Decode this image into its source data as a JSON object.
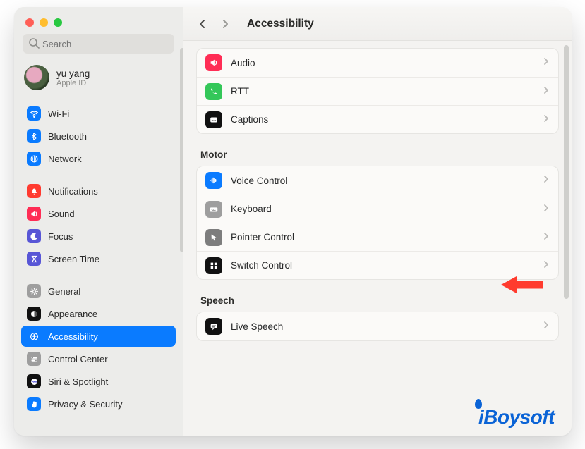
{
  "sidebar": {
    "search_placeholder": "Search",
    "account": {
      "name": "yu yang",
      "sub": "Apple ID"
    },
    "items": [
      {
        "id": "wifi",
        "label": "Wi-Fi",
        "icon": "wifi-icon",
        "color": "#0a7bff"
      },
      {
        "id": "bluetooth",
        "label": "Bluetooth",
        "icon": "bluetooth-icon",
        "color": "#0a7bff"
      },
      {
        "id": "network",
        "label": "Network",
        "icon": "globe-icon",
        "color": "#0a7bff"
      },
      {
        "id": "notifications",
        "label": "Notifications",
        "icon": "bell-icon",
        "color": "#ff3b30"
      },
      {
        "id": "sound",
        "label": "Sound",
        "icon": "speaker-icon",
        "color": "#ff2d55"
      },
      {
        "id": "focus",
        "label": "Focus",
        "icon": "moon-icon",
        "color": "#5856d6"
      },
      {
        "id": "screentime",
        "label": "Screen Time",
        "icon": "hourglass-icon",
        "color": "#5856d6"
      },
      {
        "id": "general",
        "label": "General",
        "icon": "gear-icon",
        "color": "#9e9e9e"
      },
      {
        "id": "appearance",
        "label": "Appearance",
        "icon": "appearance-icon",
        "color": "#111"
      },
      {
        "id": "accessibility",
        "label": "Accessibility",
        "icon": "accessibility-icon",
        "color": "#0a7bff",
        "selected": true
      },
      {
        "id": "controlcenter",
        "label": "Control Center",
        "icon": "switches-icon",
        "color": "#9e9e9e"
      },
      {
        "id": "siri",
        "label": "Siri & Spotlight",
        "icon": "siri-icon",
        "color": "#111"
      },
      {
        "id": "privacy",
        "label": "Privacy & Security",
        "icon": "hand-icon",
        "color": "#0a7bff"
      }
    ]
  },
  "header": {
    "title": "Accessibility",
    "back_enabled": true,
    "forward_enabled": false
  },
  "main": {
    "groups": [
      {
        "header": null,
        "rows": [
          {
            "id": "audio",
            "label": "Audio",
            "icon": "speaker-icon",
            "color": "#ff2d55"
          },
          {
            "id": "rtt",
            "label": "RTT",
            "icon": "phone-icon",
            "color": "#34c759"
          },
          {
            "id": "captions",
            "label": "Captions",
            "icon": "captions-icon",
            "color": "#111"
          }
        ]
      },
      {
        "header": "Motor",
        "rows": [
          {
            "id": "voicecontrol",
            "label": "Voice Control",
            "icon": "voice-icon",
            "color": "#0a7bff"
          },
          {
            "id": "keyboard",
            "label": "Keyboard",
            "icon": "keyboard-icon",
            "color": "#9e9e9e"
          },
          {
            "id": "pointer",
            "label": "Pointer Control",
            "icon": "cursor-icon",
            "color": "#7d7d7d",
            "highlighted": true
          },
          {
            "id": "switchcontrol",
            "label": "Switch Control",
            "icon": "grid-icon",
            "color": "#111"
          }
        ]
      },
      {
        "header": "Speech",
        "rows": [
          {
            "id": "livespeech",
            "label": "Live Speech",
            "icon": "speech-icon",
            "color": "#111"
          }
        ]
      }
    ]
  },
  "watermark": "iBoysoft"
}
